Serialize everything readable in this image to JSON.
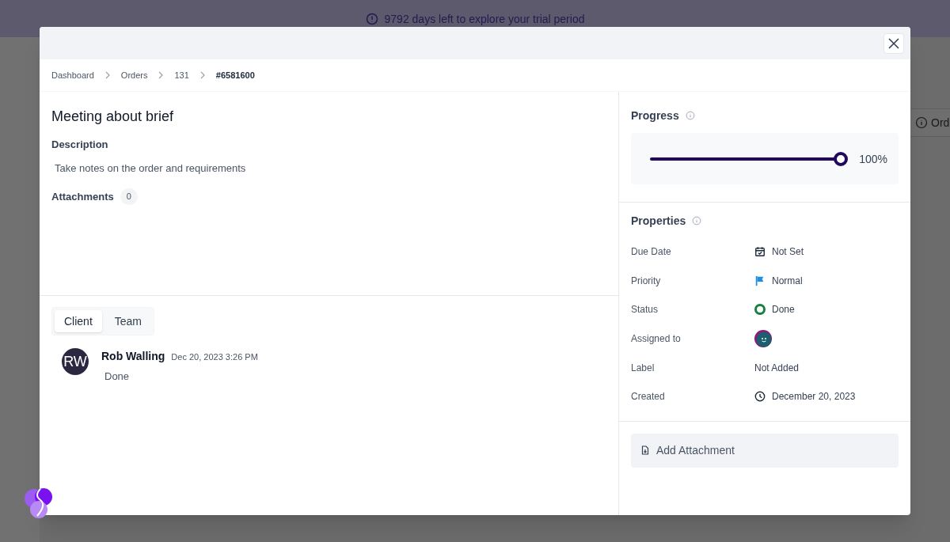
{
  "banner": {
    "text": "9792 days left to explore your trial period"
  },
  "background": {
    "row_text": "Ord"
  },
  "breadcrumbs": [
    {
      "label": "Dashboard",
      "current": false
    },
    {
      "label": "Orders",
      "current": false
    },
    {
      "label": "131",
      "current": false
    },
    {
      "label": "#6581600",
      "current": true
    }
  ],
  "task": {
    "title": "Meeting about brief",
    "description_label": "Description",
    "description": "Take notes on the order and requirements",
    "attachments_label": "Attachments",
    "attachments_count": "0"
  },
  "comment_tabs": [
    {
      "label": "Client",
      "selected": true
    },
    {
      "label": "Team",
      "selected": false
    }
  ],
  "comments": [
    {
      "initials": "RW",
      "author": "Rob Walling",
      "time": "Dec 20, 2023 3:26 PM",
      "text": "Done"
    }
  ],
  "progress": {
    "title": "Progress",
    "level": 1,
    "reading": "100%"
  },
  "properties": {
    "title": "Properties",
    "rows": [
      {
        "kind": "date",
        "label": "Due Date",
        "value": "Not Set"
      },
      {
        "kind": "priority",
        "label": "Priority",
        "value": "Normal"
      },
      {
        "kind": "status",
        "label": "Status",
        "value": "Done",
        "color": "#15803d"
      },
      {
        "kind": "assignee",
        "label": "Assigned to"
      },
      {
        "kind": "label",
        "label": "Label",
        "value": "Not Added"
      },
      {
        "kind": "created",
        "label": "Created",
        "value": "December 20, 2023"
      }
    ]
  },
  "add_attachment": {
    "label": "Add Attachment"
  }
}
